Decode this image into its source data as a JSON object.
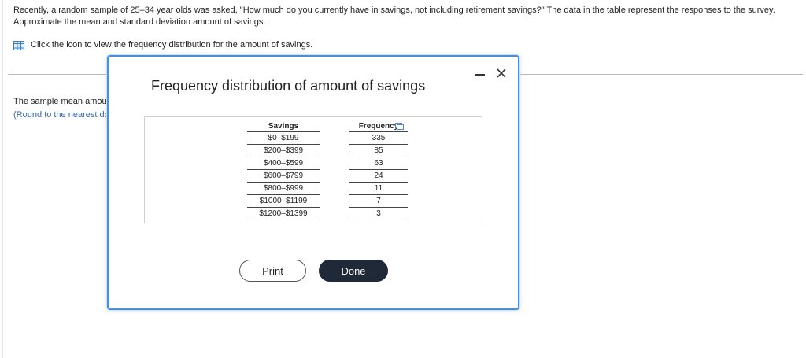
{
  "question": {
    "text": "Recently, a random sample of 25–34 year olds was asked, \"How much do you currently have in savings, not including retirement savings?\" The data in the table represent the responses to the survey. Approximate the mean and standard deviation amount of savings.",
    "icon_instruction": "Click the icon to view the frequency distribution for the amount of savings."
  },
  "background": {
    "sample_mean_partial": "The sample mean amount of savings",
    "round_note_partial": "(Round to the nearest dollar as needed.)"
  },
  "modal": {
    "title": "Frequency distribution of amount of savings",
    "table": {
      "headers": {
        "savings": "Savings",
        "frequency": "Frequency"
      },
      "rows": [
        {
          "savings": "$0–$199",
          "frequency": "335"
        },
        {
          "savings": "$200–$399",
          "frequency": "85"
        },
        {
          "savings": "$400–$599",
          "frequency": "63"
        },
        {
          "savings": "$600–$799",
          "frequency": "24"
        },
        {
          "savings": "$800–$999",
          "frequency": "11"
        },
        {
          "savings": "$1000–$1199",
          "frequency": "7"
        },
        {
          "savings": "$1200–$1399",
          "frequency": "3"
        }
      ]
    },
    "buttons": {
      "print": "Print",
      "done": "Done"
    }
  },
  "icons": {
    "table": "table-icon",
    "copy": "copy-icon",
    "minimize": "minimize-icon",
    "close": "close-icon"
  },
  "colors": {
    "accent_blue": "#4a90d9",
    "link_blue": "#3a66b0",
    "done_button": "#1f2937"
  }
}
